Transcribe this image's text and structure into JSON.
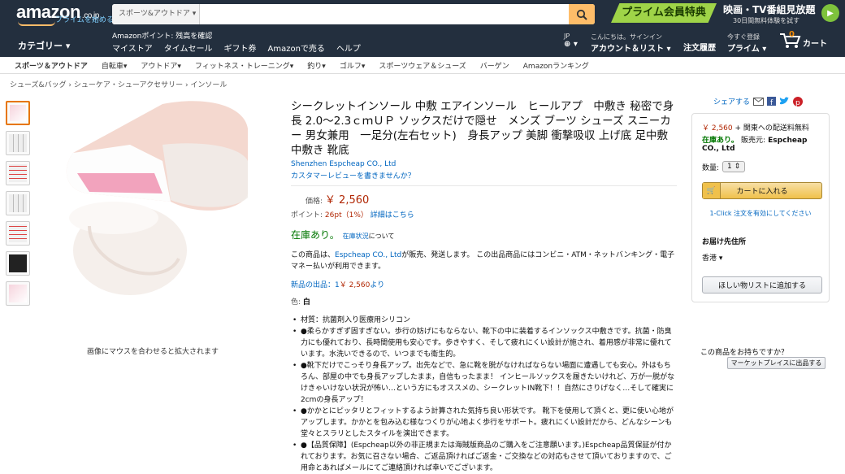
{
  "header": {
    "logo": "amazon",
    "logo_suffix": ".co.jp",
    "prime_link": "プライムを始める",
    "search_category": "スポーツ&アウトドア",
    "search_placeholder": "",
    "promo": "プライム会員特典",
    "promo_title": "映画・TV番組見放題",
    "promo_sub": "30日間無料体験を試す",
    "category_label": "カテゴリー",
    "points_link": "Amazonポイント: 残高を確認",
    "nav_links": [
      "マイストア",
      "タイムセール",
      "ギフト券",
      "Amazonで売る",
      "ヘルプ"
    ],
    "lang": "JP",
    "account_line1": "こんにちは。サインイン",
    "account_line2": "アカウント＆リスト",
    "orders": "注文履歴",
    "prime_line1": "今すぐ登録",
    "prime_line2": "プライム",
    "cart_count": "0",
    "cart_label": "カート"
  },
  "subnav": [
    "スポーツ＆アウトドア",
    "自転車",
    "アウトドア",
    "フィットネス・トレーニング",
    "釣り",
    "ゴルフ",
    "スポーツウェア＆シューズ",
    "バーゲン",
    "Amazonランキング"
  ],
  "breadcrumb": "シューズ&バッグ › シューケア・シューアクセサリー › インソール",
  "image_hint": "画像にマウスを合わせると拡大されます",
  "product": {
    "title": "シークレットインソール 中敷 エアインソール　ヒールアプ　中敷き 秘密で身長 2.0〜2.3ｃｍＵＰ ソックスだけで隠せ　メンズ ブーツ シューズ スニーカー 男女兼用　一足分(左右セット)　身長アップ 美脚 衝撃吸収 上げ底 足中敷 中敷き 靴底",
    "brand": "Shenzhen Espcheap CO., Ltd",
    "review_link": "カスタマーレビューを書きませんか？",
    "price_label": "価格:",
    "price": "￥ 2,560",
    "points_label": "ポイント:",
    "points_value": "26pt（1%）",
    "points_link": "詳細はこちら",
    "stock": "在庫あり。",
    "stock_link": "在庫状況",
    "stock_suffix": "について",
    "seller_prefix": "この商品は、",
    "seller_name": "Espcheap CO., Ltd",
    "seller_text": "が販売、発送します。 この出品商品にはコンビニ・ATM・ネットバンキング・電子マネー払いが利用できます。",
    "new_items": "新品の出品：1",
    "new_items_price": "￥ 2,560",
    "new_items_suffix": "より",
    "color_label": "色:",
    "color_value": "白",
    "bullets": [
      "材質：抗菌剤入り医療用シリコン",
      "●柔らかすぎず固すぎない。歩行の妨げにもならない、靴下の中に装着するインソックス中敷きです。抗菌・防臭力にも優れており、長時間使用も安心です。歩きやすく、そして疲れにくい設計が施され、着用感が非常に優れています。水洗いできるので、いつまでも衛生的。",
      "●靴下だけでこっそり身長アップ。出先などで、急に靴を脱がなければならない場面に遭遇しても安心。外はもちろん、部屋の中でも身長アップしたまま，自信もったまま！ インヒールソックスを履きたいけれど、万が一脱がなけきゃいけない状況が怖い…という方にもオススメの、シークレットIN靴下！！自然にさりげなく…そして確実に2cmの身長アップ！",
      "●かかとにピッタリとフィットするよう計算された気持ち良い形状です。 靴下を使用して頂くと、更に使い心地がアップします。かかとを包み込む様なつくりが心地よく歩行をサポート。疲れにくい設計だから、どんなシーンも堂々とスラリとしたスタイルを演出できます。",
      "●【品質保障】(Espcheap以外の非正規または海賊版商品のご購入をご注意願います。)Espcheap品質保証が付かれております。お気に召さない場合、ご返品頂ければご返金・ご交換などの対応もさせて頂いておりますので、ご用命とあればメールにてご連絡頂ければ幸いでございます。"
    ]
  },
  "buybox": {
    "share": "シェアする",
    "price": "￥ 2,560",
    "shipping": "+ 関東への配送料無料",
    "stock": "在庫あり。",
    "seller_label": "販売元:",
    "seller": "Espcheap CO., Ltd",
    "qty_label": "数量:",
    "qty_value": "1",
    "cart_button": "カートに入れる",
    "oneclick": "1-Click 注文を有効にしてください",
    "ship_title": "お届け先住所",
    "ship_value": "香港",
    "wishlist": "ほしい物リストに追加する",
    "sell_question": "この商品をお持ちですか？",
    "sell_button": "マーケットプレイスに出品する"
  }
}
